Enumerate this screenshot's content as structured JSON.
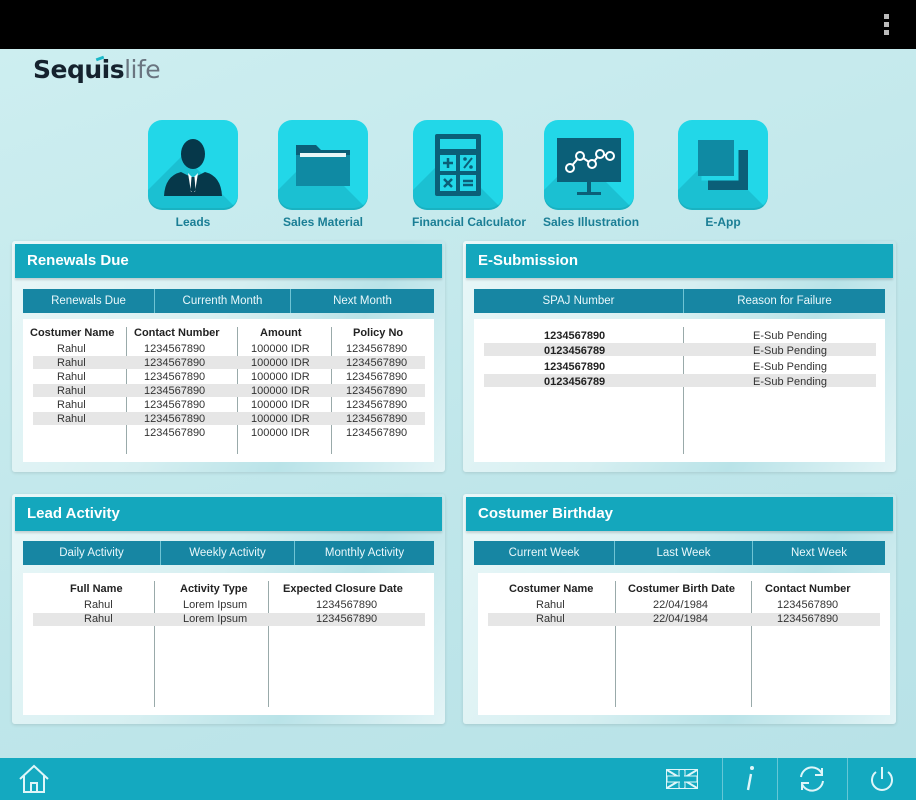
{
  "brand": {
    "main": "Sequis",
    "sub": "life"
  },
  "nav": [
    {
      "label": "Leads",
      "icon": "person-icon"
    },
    {
      "label": "Sales Material",
      "icon": "folder-icon"
    },
    {
      "label": "Financial Calculator",
      "icon": "calculator-icon"
    },
    {
      "label": "Sales Illustration",
      "icon": "chart-monitor-icon"
    },
    {
      "label": "E-App",
      "icon": "stacked-squares-icon"
    }
  ],
  "renewals": {
    "title": "Renewals Due",
    "tabs": [
      "Renewals Due",
      "Currenth Month",
      "Next Month"
    ],
    "headers": [
      "Costumer Name",
      "Contact Number",
      "Amount",
      "Policy No"
    ],
    "rows": [
      [
        "Rahul",
        "1234567890",
        "100000 IDR",
        "1234567890"
      ],
      [
        "Rahul",
        "1234567890",
        "100000 IDR",
        "1234567890"
      ],
      [
        "Rahul",
        "1234567890",
        "100000 IDR",
        "1234567890"
      ],
      [
        "Rahul",
        "1234567890",
        "100000 IDR",
        "1234567890"
      ],
      [
        "Rahul",
        "1234567890",
        "100000 IDR",
        "1234567890"
      ],
      [
        "Rahul",
        "1234567890",
        "100000 IDR",
        "1234567890"
      ],
      [
        "",
        "1234567890",
        "100000 IDR",
        "1234567890"
      ]
    ]
  },
  "esubmission": {
    "title": "E-Submission",
    "tabs": [
      "SPAJ Number",
      "Reason for Failure"
    ],
    "rows": [
      [
        "1234567890",
        "E-Sub Pending"
      ],
      [
        "0123456789",
        "E-Sub Pending"
      ],
      [
        "1234567890",
        "E-Sub Pending"
      ],
      [
        "0123456789",
        "E-Sub Pending"
      ]
    ]
  },
  "lead_activity": {
    "title": "Lead Activity",
    "tabs": [
      "Daily Activity",
      "Weekly Activity",
      "Monthly Activity"
    ],
    "headers": [
      "Full Name",
      "Activity Type",
      "Expected Closure Date"
    ],
    "rows": [
      [
        "Rahul",
        "Lorem Ipsum",
        "1234567890"
      ],
      [
        "Rahul",
        "Lorem Ipsum",
        "1234567890"
      ]
    ]
  },
  "birthday": {
    "title": "Costumer Birthday",
    "tabs": [
      "Current Week",
      "Last Week",
      "Next Week"
    ],
    "headers": [
      "Costumer Name",
      "Costumer Birth Date",
      "Contact Number"
    ],
    "rows": [
      [
        "Rahul",
        "22/04/1984",
        "1234567890"
      ],
      [
        "Rahul",
        "22/04/1984",
        "1234567890"
      ]
    ]
  },
  "bottom_icons": [
    "home-icon",
    "uk-flag-icon",
    "info-icon",
    "refresh-icon",
    "power-icon"
  ]
}
